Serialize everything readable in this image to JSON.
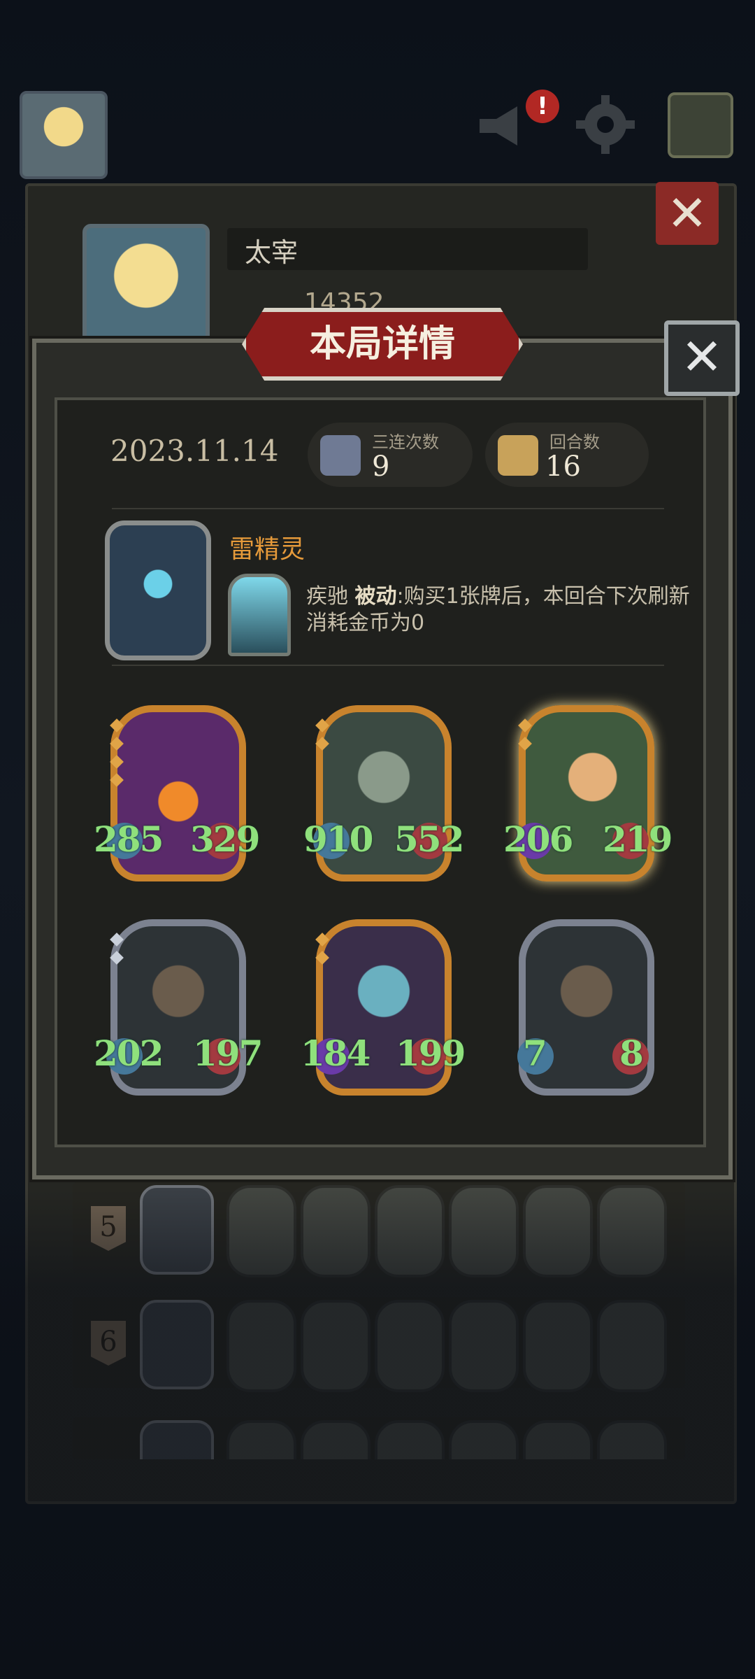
{
  "player": {
    "name": "太宰",
    "score": "14352"
  },
  "modal": {
    "title": "本局详情",
    "date": "2023.11.14",
    "stats": [
      {
        "label": "三连次数",
        "value": "9"
      },
      {
        "label": "回合数",
        "value": "16"
      }
    ],
    "hero": {
      "name": "雷精灵",
      "skill_name": "疾驰",
      "skill_type": "被动",
      "skill_desc": ":购买1张牌后，本回合下次刷新消耗金币为0"
    },
    "cards": [
      {
        "atk": "285",
        "hp": "329"
      },
      {
        "atk": "910",
        "hp": "552"
      },
      {
        "atk": "206",
        "hp": "219"
      },
      {
        "atk": "202",
        "hp": "197"
      },
      {
        "atk": "184",
        "hp": "199"
      },
      {
        "atk": "7",
        "hp": "8"
      }
    ]
  },
  "history_rows": [
    {
      "rank": "5"
    },
    {
      "rank": "6"
    }
  ],
  "colors": {
    "title_red": "#8b1d1c",
    "stat_green": "#8fe07c",
    "hero_orange": "#e69a3a"
  }
}
